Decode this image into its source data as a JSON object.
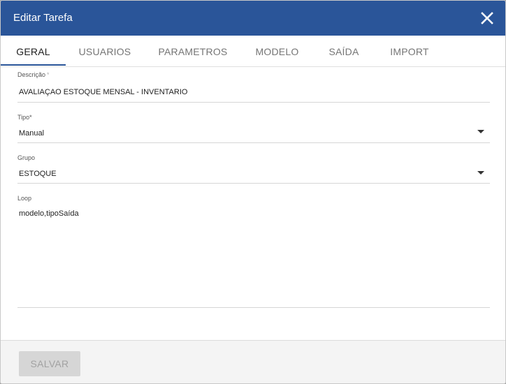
{
  "dialog": {
    "title": "Editar Tarefa",
    "close_icon": "close-icon"
  },
  "tabs": [
    {
      "label": "GERAL",
      "active": true
    },
    {
      "label": "USUARIOS",
      "active": false
    },
    {
      "label": "PARAMETROS",
      "active": false
    },
    {
      "label": "MODELO",
      "active": false
    },
    {
      "label": "SAÍDA",
      "active": false
    },
    {
      "label": "IMPORT",
      "active": false
    }
  ],
  "form": {
    "descricao": {
      "label": "Descrição",
      "required_mark": "*",
      "value": "AVALIAÇAO ESTOQUE MENSAL - INVENTARIO"
    },
    "tipo": {
      "label": "Tipo*",
      "value": "Manual"
    },
    "grupo": {
      "label": "Grupo",
      "value": "ESTOQUE"
    },
    "loop": {
      "label": "Loop",
      "value": "modelo,tipoSaída"
    }
  },
  "footer": {
    "save_label": "SALVAR",
    "save_enabled": false
  },
  "colors": {
    "header_bg": "#2a5599",
    "tab_indicator": "#2a5599",
    "disabled_button_bg": "#d6d6d6",
    "disabled_button_text": "#a2a2a2"
  }
}
